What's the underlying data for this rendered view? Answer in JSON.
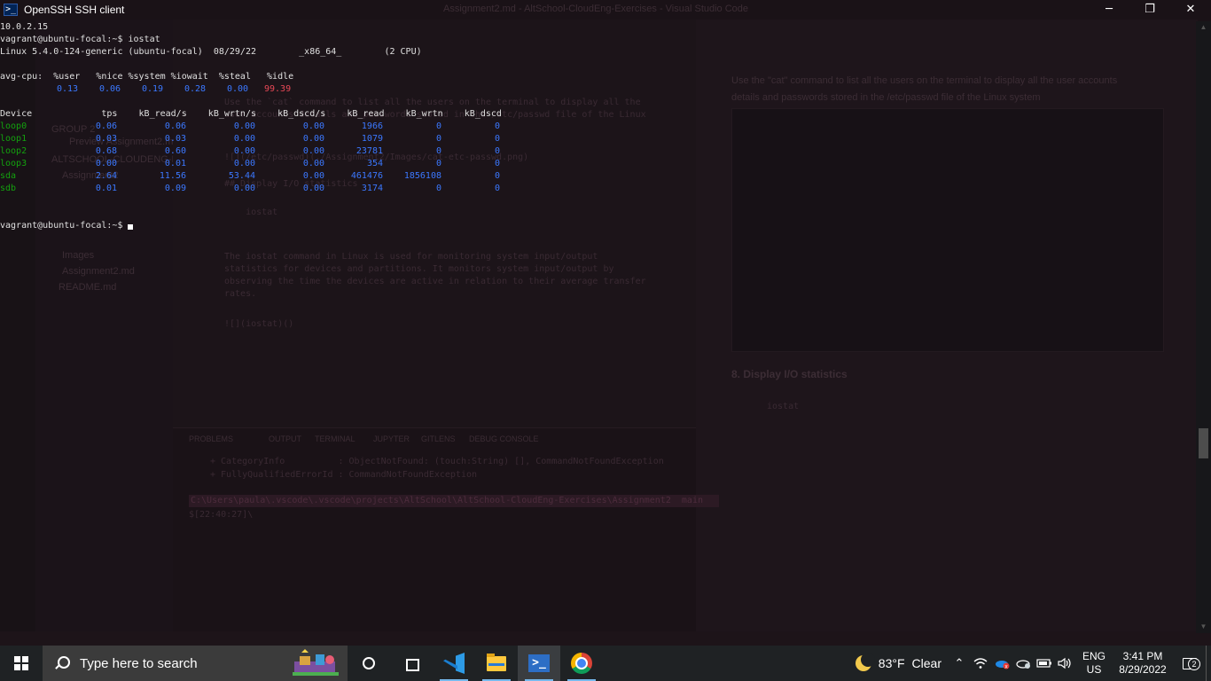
{
  "window": {
    "title": "OpenSSH SSH client",
    "icon": "powershell-icon",
    "controls": {
      "minimize": "─",
      "restore": "❐",
      "close": "✕"
    }
  },
  "terminal": {
    "lines": [
      "10.0.2.15",
      "vagrant@ubuntu-focal:~$ iostat",
      "Linux 5.4.0-124-generic (ubuntu-focal)  08/29/22        _x86_64_        (2 CPU)",
      "",
      "avg-cpu:  %user   %nice %system %iowait  %steal   %idle",
      "",
      "",
      "",
      "Device             tps    kB_read/s    kB_wrtn/s    kB_dscd/s    kB_read    kB_wrtn    kB_dscd"
    ],
    "cpu_values": [
      "0.13",
      "0.06",
      "0.19",
      "0.28",
      "0.00",
      "99.39"
    ],
    "devices": [
      {
        "name": "loop0",
        "tps": "0.06",
        "kB_read_s": "0.06",
        "kB_wrtn_s": "0.00",
        "kB_dscd_s": "0.00",
        "kB_read": "1966",
        "kB_wrtn": "0",
        "kB_dscd": "0"
      },
      {
        "name": "loop1",
        "tps": "0.03",
        "kB_read_s": "0.03",
        "kB_wrtn_s": "0.00",
        "kB_dscd_s": "0.00",
        "kB_read": "1079",
        "kB_wrtn": "0",
        "kB_dscd": "0"
      },
      {
        "name": "loop2",
        "tps": "0.68",
        "kB_read_s": "0.60",
        "kB_wrtn_s": "0.00",
        "kB_dscd_s": "0.00",
        "kB_read": "23781",
        "kB_wrtn": "0",
        "kB_dscd": "0"
      },
      {
        "name": "loop3",
        "tps": "0.00",
        "kB_read_s": "0.01",
        "kB_wrtn_s": "0.00",
        "kB_dscd_s": "0.00",
        "kB_read": "354",
        "kB_wrtn": "0",
        "kB_dscd": "0"
      },
      {
        "name": "sda",
        "tps": "2.64",
        "kB_read_s": "11.56",
        "kB_wrtn_s": "53.44",
        "kB_dscd_s": "0.00",
        "kB_read": "461476",
        "kB_wrtn": "1856108",
        "kB_dscd": "0"
      },
      {
        "name": "sdb",
        "tps": "0.01",
        "kB_read_s": "0.09",
        "kB_wrtn_s": "0.00",
        "kB_dscd_s": "0.00",
        "kB_read": "3174",
        "kB_wrtn": "0",
        "kB_dscd": "0"
      }
    ],
    "final_prompt": "vagrant@ubuntu-focal:~$ "
  },
  "background_vscode": {
    "title": "Assignment2.md - AltSchool-CloudEng-Exercises - Visual Studio Code",
    "explorer_items": [
      "GROUP 2",
      "Preview Assignment2.md",
      "ALTSCHOOL-CLOUDENG-EXER...",
      "Assignment2",
      "Images",
      "Assignment2.md",
      "README.md"
    ],
    "editor_lines": [
      "Use the `cat` command to list all the users on the terminal to display all the",
      "user accounts details and passwords stored in the /etc/passwd file of the Linux",
      "![](/etc/passwd)(./Assignment2/Images/cat-etc-passwd.png)",
      "## Display I/O statistics",
      "    iostat",
      "The iostat command in Linux is used for monitoring system input/output",
      "statistics for devices and partitions. It monitors system input/output by",
      "observing the time the devices are active in relation to their average transfer",
      "rates.",
      "![](iostat)()"
    ],
    "preview_text": "Use the \"cat\" command to list all the users on the terminal to display all the user accounts details and passwords stored in the /etc/passwd file of the Linux system",
    "preview_heading": "8. Display I/O statistics",
    "preview_code": "iostat",
    "panel_tabs": [
      "PROBLEMS",
      "OUTPUT",
      "TERMINAL",
      "JUPYTER",
      "GITLENS",
      "DEBUG CONSOLE"
    ],
    "panel_path": "C:\\Users\\paula\\.vscode\\.vscode\\projects\\AltSchool\\AltSchool-CloudEng-Exercises\\Assignment2",
    "panel_branch": "main",
    "panel_prompt": "$[22:40:27]\\",
    "panel_lines": [
      "+ CategoryInfo          : ObjectNotFound: (touch:String) [], CommandNotFoundException",
      "+ FullyQualifiedErrorId : CommandNotFoundException"
    ]
  },
  "taskbar": {
    "search_placeholder": "Type here to search",
    "apps": [
      "task-view",
      "vscode",
      "file-explorer",
      "powershell",
      "chrome"
    ],
    "weather": {
      "temp": "83°F",
      "condition": "Clear"
    },
    "language": {
      "lang": "ENG",
      "region": "US"
    },
    "clock": {
      "time": "3:41 PM",
      "date": "8/29/2022"
    },
    "notification_count": "2"
  }
}
